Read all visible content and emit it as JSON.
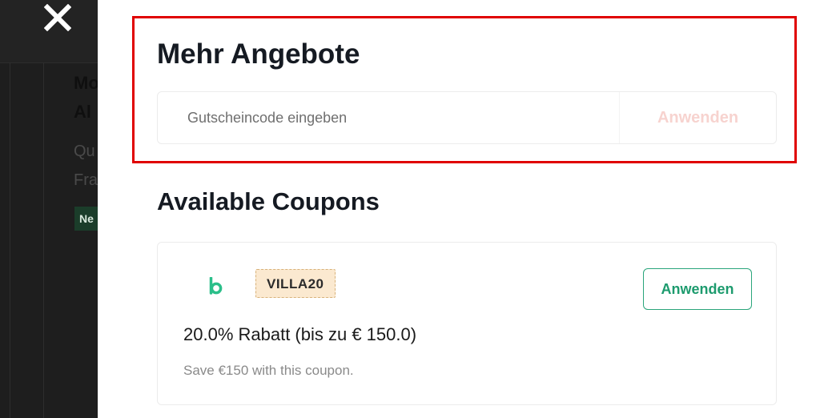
{
  "background": {
    "title_lines": [
      "Mo",
      "Al"
    ],
    "sub_lines": [
      "Qu",
      "Fra"
    ],
    "badge": "Ne"
  },
  "close": {
    "icon": "close-icon"
  },
  "promo": {
    "title": "Mehr Angebote",
    "input_placeholder": "Gutscheincode eingeben",
    "input_value": "",
    "apply_label": "Anwenden"
  },
  "coupons": {
    "title": "Available Coupons",
    "items": [
      {
        "brand_icon": "brand-b-logo-icon",
        "code": "VILLA20",
        "apply_label": "Anwenden",
        "title": "20.0% Rabatt (bis zu € 150.0)",
        "description": "Save €150 with this coupon."
      }
    ]
  },
  "colors": {
    "accent_green": "#1d9b6e",
    "highlight_red": "#e00000",
    "code_bg": "#fbe9d0",
    "disabled_apply": "#f7d3cf"
  }
}
